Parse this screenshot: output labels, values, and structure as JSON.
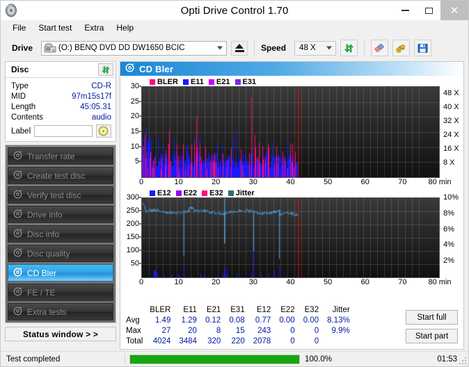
{
  "window": {
    "title": "Opti Drive Control 1.70",
    "app_icon": "disc-icon",
    "minimize": "–",
    "maximize": "□",
    "close": "✕"
  },
  "menu": {
    "items": [
      "File",
      "Start test",
      "Extra",
      "Help"
    ]
  },
  "toolbar": {
    "drive_label": "Drive",
    "drive_value": "(O:)   BENQ DVD DD DW1650 BCIC",
    "eject_icon": "eject-icon",
    "speed_label": "Speed",
    "speed_value": "48 X",
    "refresh_icon": "refresh-icon",
    "erase_icon": "eraser-icon",
    "tools_icon": "tools-icon",
    "save_icon": "save-icon"
  },
  "disc_panel": {
    "header": "Disc",
    "refresh_icon": "refresh-icon",
    "rows": [
      {
        "key": "Type",
        "value": "CD-R"
      },
      {
        "key": "MID",
        "value": "97m15s17f"
      },
      {
        "key": "Length",
        "value": "45:05.31"
      },
      {
        "key": "Contents",
        "value": "audio"
      }
    ],
    "label_key": "Label",
    "label_value": "",
    "label_placeholder": "",
    "disc_button_icon": "cd-disc-icon"
  },
  "nav": {
    "items": [
      {
        "label": "Transfer rate",
        "icon": "disc-icon",
        "active": false
      },
      {
        "label": "Create test disc",
        "icon": "disc-icon",
        "active": false
      },
      {
        "label": "Verify test disc",
        "icon": "disc-icon",
        "active": false
      },
      {
        "label": "Drive info",
        "icon": "disc-icon",
        "active": false
      },
      {
        "label": "Disc info",
        "icon": "disc-icon",
        "active": false
      },
      {
        "label": "Disc quality",
        "icon": "disc-icon",
        "active": false
      },
      {
        "label": "CD Bler",
        "icon": "disc-icon",
        "active": true
      },
      {
        "label": "FE / TE",
        "icon": "disc-icon",
        "active": false
      },
      {
        "label": "Extra tests",
        "icon": "disc-icon",
        "active": false
      }
    ],
    "status_window_button": "Status window > >"
  },
  "panel": {
    "title": "CD Bler",
    "icon": "disc-icon"
  },
  "stats": {
    "columns": [
      "BLER",
      "E11",
      "E21",
      "E31",
      "E12",
      "E22",
      "E32",
      "Jitter"
    ],
    "rows": [
      {
        "label": "Avg",
        "values": [
          "1.49",
          "1.29",
          "0.12",
          "0.08",
          "0.77",
          "0.00",
          "0.00",
          "8.13%"
        ]
      },
      {
        "label": "Max",
        "values": [
          "27",
          "20",
          "8",
          "15",
          "243",
          "0",
          "0",
          "9.9%"
        ]
      },
      {
        "label": "Total",
        "values": [
          "4024",
          "3484",
          "320",
          "220",
          "2078",
          "0",
          "0",
          ""
        ]
      }
    ],
    "start_full": "Start full",
    "start_part": "Start part"
  },
  "statusbar": {
    "message": "Test completed",
    "percent_label": "100.0%",
    "percent_value": 100,
    "elapsed": "01:53",
    "progress_color": "#16a60f"
  },
  "chart_data": [
    {
      "type": "line",
      "name": "bler-chart",
      "title": "",
      "xlabel": "min",
      "ylabel": "",
      "x": [
        0,
        80
      ],
      "xlim": [
        0,
        80
      ],
      "xticks": [
        0,
        10,
        20,
        30,
        40,
        50,
        60,
        70,
        80
      ],
      "xticklabels": [
        "0",
        "10",
        "20",
        "30",
        "40",
        "50",
        "60",
        "70",
        "80 min"
      ],
      "ylim": [
        0,
        30
      ],
      "yticks": [
        5,
        10,
        15,
        20,
        25,
        30
      ],
      "yticklabels": [
        "5",
        "10",
        "15",
        "20",
        "25",
        "30"
      ],
      "y2lim": [
        0,
        52
      ],
      "y2ticks": [
        8,
        16,
        24,
        32,
        40,
        48
      ],
      "y2ticklabels": [
        "8 X",
        "16 X",
        "24 X",
        "32 X",
        "40 X",
        "48 X"
      ],
      "grid": true,
      "legend": [
        {
          "name": "BLER",
          "color": "#ff0a78"
        },
        {
          "name": "E11",
          "color": "#1a1aff"
        },
        {
          "name": "E21",
          "color": "#c800ff"
        },
        {
          "name": "E31",
          "color": "#7a2ae0"
        }
      ],
      "data_end_min": 45.1,
      "marker_line_min": 45.1,
      "marker_color": "#ff0000",
      "bler_avg": 1.49,
      "bler_max": 27,
      "e11_avg": 1.29,
      "e11_max": 20
    },
    {
      "type": "line",
      "name": "e12-jitter-chart",
      "title": "",
      "xlabel": "min",
      "ylabel": "",
      "xlim": [
        0,
        80
      ],
      "xticks": [
        0,
        10,
        20,
        30,
        40,
        50,
        60,
        70,
        80
      ],
      "xticklabels": [
        "0",
        "10",
        "20",
        "30",
        "40",
        "50",
        "60",
        "70",
        "80 min"
      ],
      "ylim": [
        0,
        300
      ],
      "yticks": [
        50,
        100,
        150,
        200,
        250,
        300
      ],
      "yticklabels": [
        "50",
        "100",
        "150",
        "200",
        "250",
        "300"
      ],
      "y2lim": [
        0,
        10
      ],
      "y2ticks": [
        2,
        4,
        6,
        8,
        10
      ],
      "y2ticklabels": [
        "2%",
        "4%",
        "6%",
        "8%",
        "10%"
      ],
      "grid": true,
      "legend": [
        {
          "name": "E12",
          "color": "#1a1aff"
        },
        {
          "name": "E22",
          "color": "#9b00e8"
        },
        {
          "name": "E32",
          "color": "#ff0a78"
        },
        {
          "name": "Jitter",
          "color": "#2e6e6e"
        }
      ],
      "data_end_min": 45.1,
      "marker_line_min": 45.1,
      "marker_color": "#ff0000",
      "jitter_avg_pct": 8.13,
      "jitter_max_pct": 9.9,
      "jitter_color": "#4aa8ef",
      "e12_avg": 0.77,
      "e12_max": 243,
      "e12_spikes_min": [
        12,
        23.8,
        32.2,
        39.6
      ]
    }
  ]
}
